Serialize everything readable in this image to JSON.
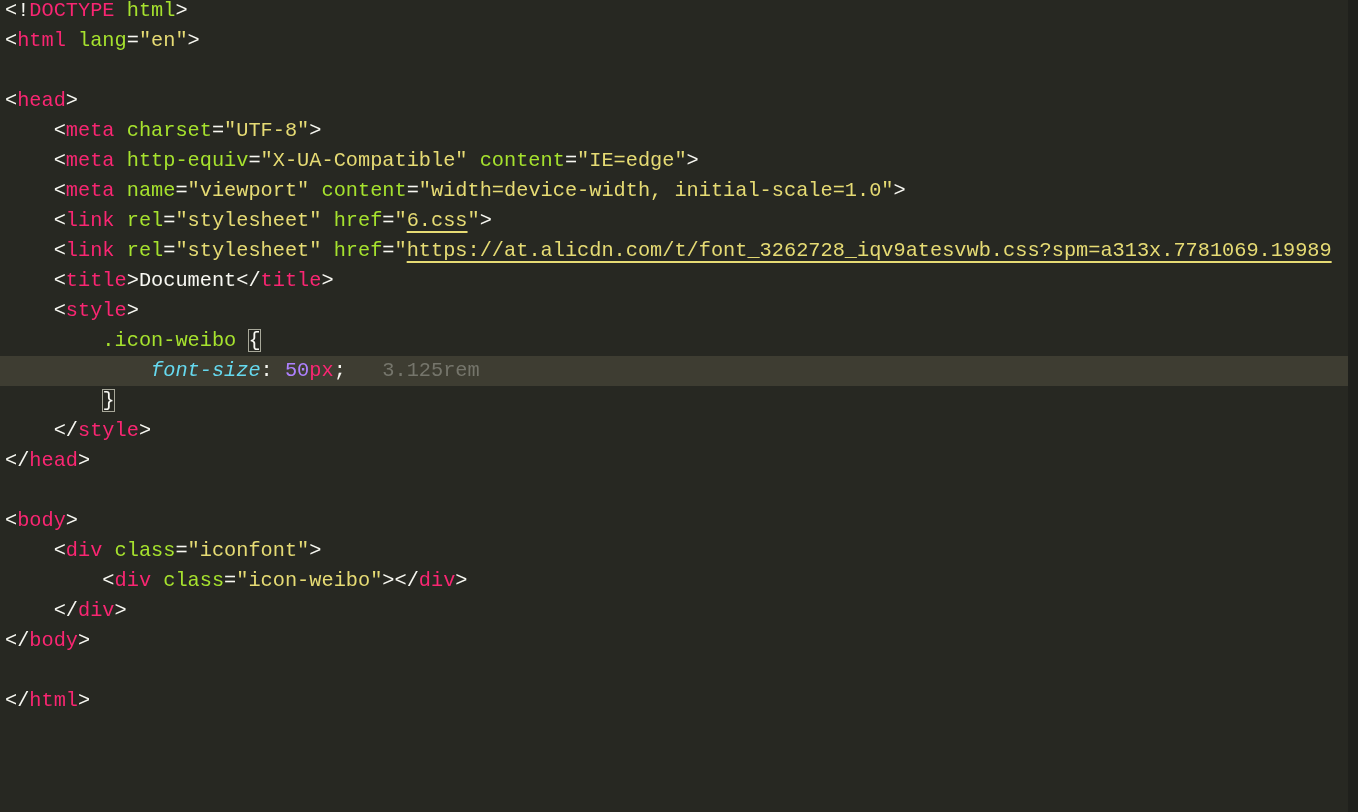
{
  "editor": {
    "lines": [
      {
        "current": false,
        "tokens": [
          {
            "kind": "punct",
            "text": "<!"
          },
          {
            "kind": "tag",
            "text": "DOCTYPE"
          },
          {
            "kind": "attr",
            "text": " html"
          },
          {
            "kind": "punct",
            "text": ">"
          }
        ]
      },
      {
        "current": false,
        "tokens": [
          {
            "kind": "punct",
            "text": "<"
          },
          {
            "kind": "tag",
            "text": "html"
          },
          {
            "kind": "attr",
            "text": " lang"
          },
          {
            "kind": "punct",
            "text": "="
          },
          {
            "kind": "string",
            "text": "\"en\""
          },
          {
            "kind": "punct",
            "text": ">"
          }
        ]
      },
      {
        "current": false
      },
      {
        "current": false,
        "tokens": [
          {
            "kind": "punct",
            "text": "<"
          },
          {
            "kind": "tag",
            "text": "head"
          },
          {
            "kind": "punct",
            "text": ">"
          }
        ]
      },
      {
        "current": false,
        "tokens": [
          {
            "kind": "punct",
            "text": "    <"
          },
          {
            "kind": "tag",
            "text": "meta"
          },
          {
            "kind": "attr",
            "text": " charset"
          },
          {
            "kind": "punct",
            "text": "="
          },
          {
            "kind": "string",
            "text": "\"UTF-8\""
          },
          {
            "kind": "punct",
            "text": ">"
          }
        ]
      },
      {
        "current": false,
        "tokens": [
          {
            "kind": "punct",
            "text": "    <"
          },
          {
            "kind": "tag",
            "text": "meta"
          },
          {
            "kind": "attr",
            "text": " http-equiv"
          },
          {
            "kind": "punct",
            "text": "="
          },
          {
            "kind": "string",
            "text": "\"X-UA-Compatible\""
          },
          {
            "kind": "attr",
            "text": " content"
          },
          {
            "kind": "punct",
            "text": "="
          },
          {
            "kind": "string",
            "text": "\"IE=edge\""
          },
          {
            "kind": "punct",
            "text": ">"
          }
        ]
      },
      {
        "current": false,
        "tokens": [
          {
            "kind": "punct",
            "text": "    <"
          },
          {
            "kind": "tag",
            "text": "meta"
          },
          {
            "kind": "attr",
            "text": " name"
          },
          {
            "kind": "punct",
            "text": "="
          },
          {
            "kind": "string",
            "text": "\"viewport\""
          },
          {
            "kind": "attr",
            "text": " content"
          },
          {
            "kind": "punct",
            "text": "="
          },
          {
            "kind": "string",
            "text": "\"width=device-width, initial-scale=1.0\""
          },
          {
            "kind": "punct",
            "text": ">"
          }
        ]
      },
      {
        "current": false,
        "tokens": [
          {
            "kind": "punct",
            "text": "    <"
          },
          {
            "kind": "tag",
            "text": "link"
          },
          {
            "kind": "attr",
            "text": " rel"
          },
          {
            "kind": "punct",
            "text": "="
          },
          {
            "kind": "string",
            "text": "\"stylesheet\""
          },
          {
            "kind": "attr",
            "text": " href"
          },
          {
            "kind": "punct",
            "text": "="
          },
          {
            "kind": "string",
            "text": "\""
          },
          {
            "kind": "link",
            "text": "6.css"
          },
          {
            "kind": "string",
            "text": "\""
          },
          {
            "kind": "punct",
            "text": ">"
          }
        ]
      },
      {
        "current": false,
        "tokens": [
          {
            "kind": "punct",
            "text": "    <"
          },
          {
            "kind": "tag",
            "text": "link"
          },
          {
            "kind": "attr",
            "text": " rel"
          },
          {
            "kind": "punct",
            "text": "="
          },
          {
            "kind": "string",
            "text": "\"stylesheet\""
          },
          {
            "kind": "attr",
            "text": " href"
          },
          {
            "kind": "punct",
            "text": "="
          },
          {
            "kind": "string",
            "text": "\""
          },
          {
            "kind": "link",
            "text": "https://at.alicdn.com/t/font_3262728_iqv9atesvwb.css?spm=a313x.7781069.19989"
          }
        ]
      },
      {
        "current": false,
        "tokens": [
          {
            "kind": "punct",
            "text": "    <"
          },
          {
            "kind": "tag",
            "text": "title"
          },
          {
            "kind": "punct",
            "text": ">Document</"
          },
          {
            "kind": "tag",
            "text": "title"
          },
          {
            "kind": "punct",
            "text": ">"
          }
        ]
      },
      {
        "current": false,
        "tokens": [
          {
            "kind": "punct",
            "text": "    <"
          },
          {
            "kind": "tag",
            "text": "style"
          },
          {
            "kind": "punct",
            "text": ">"
          }
        ]
      },
      {
        "current": false,
        "tokens": [
          {
            "kind": "attr",
            "text": "        .icon-weibo "
          },
          {
            "kind": "punct",
            "text": "{",
            "matched": true
          }
        ]
      },
      {
        "current": true,
        "tokens": [
          {
            "kind": "property",
            "text": "            font-size"
          },
          {
            "kind": "punct",
            "text": ": "
          },
          {
            "kind": "number",
            "text": "50"
          },
          {
            "kind": "tag",
            "text": "px"
          },
          {
            "kind": "punct",
            "text": ";"
          },
          {
            "kind": "hint",
            "text": "   3.125rem"
          }
        ]
      },
      {
        "current": false,
        "tokens": [
          {
            "kind": "punct",
            "text": "        }",
            "matched": true
          }
        ]
      },
      {
        "current": false,
        "tokens": [
          {
            "kind": "punct",
            "text": "    </"
          },
          {
            "kind": "tag",
            "text": "style"
          },
          {
            "kind": "punct",
            "text": ">"
          }
        ]
      },
      {
        "current": false,
        "tokens": [
          {
            "kind": "punct",
            "text": "</"
          },
          {
            "kind": "tag",
            "text": "head"
          },
          {
            "kind": "punct",
            "text": ">"
          }
        ]
      },
      {
        "current": false
      },
      {
        "current": false,
        "tokens": [
          {
            "kind": "punct",
            "text": "<"
          },
          {
            "kind": "tag",
            "text": "body"
          },
          {
            "kind": "punct",
            "text": ">"
          }
        ]
      },
      {
        "current": false,
        "tokens": [
          {
            "kind": "punct",
            "text": "    <"
          },
          {
            "kind": "tag",
            "text": "div"
          },
          {
            "kind": "attr",
            "text": " class"
          },
          {
            "kind": "punct",
            "text": "="
          },
          {
            "kind": "string",
            "text": "\"iconfont\""
          },
          {
            "kind": "punct",
            "text": ">"
          }
        ]
      },
      {
        "current": false,
        "tokens": [
          {
            "kind": "punct",
            "text": "        <"
          },
          {
            "kind": "tag",
            "text": "div"
          },
          {
            "kind": "attr",
            "text": " class"
          },
          {
            "kind": "punct",
            "text": "="
          },
          {
            "kind": "string",
            "text": "\"icon-weibo\""
          },
          {
            "kind": "punct",
            "text": "></"
          },
          {
            "kind": "tag",
            "text": "div"
          },
          {
            "kind": "punct",
            "text": ">"
          }
        ]
      },
      {
        "current": false,
        "tokens": [
          {
            "kind": "punct",
            "text": "    </"
          },
          {
            "kind": "tag",
            "text": "div"
          },
          {
            "kind": "punct",
            "text": ">"
          }
        ]
      },
      {
        "current": false,
        "tokens": [
          {
            "kind": "punct",
            "text": "</"
          },
          {
            "kind": "tag",
            "text": "body"
          },
          {
            "kind": "punct",
            "text": ">"
          }
        ]
      },
      {
        "current": false
      },
      {
        "current": false,
        "tokens": [
          {
            "kind": "punct",
            "text": "</"
          },
          {
            "kind": "tag",
            "text": "html"
          },
          {
            "kind": "punct",
            "text": ">"
          }
        ]
      }
    ]
  }
}
